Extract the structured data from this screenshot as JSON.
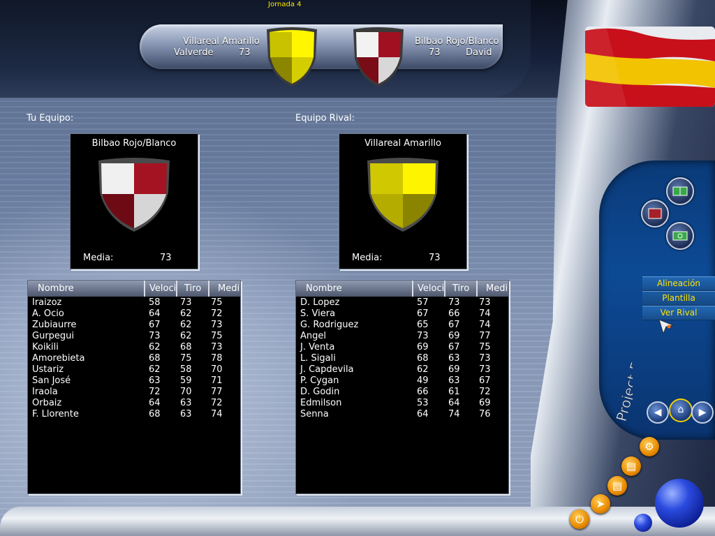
{
  "header": {
    "jornada": "Jornada 4",
    "home_team": "Villareal Amarillo",
    "home_coach": "Valverde",
    "home_rating": "73",
    "away_team": "Bilbao Rojo/Blanco",
    "away_rating": "73",
    "away_coach": "David"
  },
  "labels": {
    "your_team": "Tu Equipo:",
    "rival_team": "Equipo Rival:"
  },
  "my_team": {
    "name": "Bilbao Rojo/Blanco",
    "media_label": "Media:",
    "media_value": "73",
    "colors": {
      "primary": "#ffffff",
      "secondary": "#9a0f1c"
    }
  },
  "rival_team": {
    "name": "Villareal Amarillo",
    "media_label": "Media:",
    "media_value": "73",
    "colors": {
      "primary": "#f0e800",
      "secondary": "#8a8400"
    }
  },
  "table_columns": [
    "Nombre",
    "Velocidad",
    "Tiro",
    "Media"
  ],
  "my_players": [
    {
      "name": "Iraizoz",
      "vel": "58",
      "tiro": "73",
      "media": "75"
    },
    {
      "name": "A. Ocio",
      "vel": "64",
      "tiro": "62",
      "media": "72"
    },
    {
      "name": "Zubiaurre",
      "vel": "67",
      "tiro": "62",
      "media": "73"
    },
    {
      "name": "Gurpegui",
      "vel": "73",
      "tiro": "62",
      "media": "75"
    },
    {
      "name": "Koikili",
      "vel": "62",
      "tiro": "68",
      "media": "73"
    },
    {
      "name": "Amorebieta",
      "vel": "68",
      "tiro": "75",
      "media": "78"
    },
    {
      "name": "Ustariz",
      "vel": "62",
      "tiro": "58",
      "media": "70"
    },
    {
      "name": "San José",
      "vel": "63",
      "tiro": "59",
      "media": "71"
    },
    {
      "name": "Iraola",
      "vel": "72",
      "tiro": "70",
      "media": "77"
    },
    {
      "name": "Orbaiz",
      "vel": "64",
      "tiro": "63",
      "media": "72"
    },
    {
      "name": "F. Llorente",
      "vel": "68",
      "tiro": "63",
      "media": "74"
    }
  ],
  "rival_players": [
    {
      "name": "D. Lopez",
      "vel": "57",
      "tiro": "73",
      "media": "73"
    },
    {
      "name": "S. Viera",
      "vel": "67",
      "tiro": "66",
      "media": "74"
    },
    {
      "name": "G. Rodriguez",
      "vel": "65",
      "tiro": "67",
      "media": "74"
    },
    {
      "name": "Angel",
      "vel": "73",
      "tiro": "69",
      "media": "77"
    },
    {
      "name": "J. Venta",
      "vel": "69",
      "tiro": "67",
      "media": "75"
    },
    {
      "name": "L. Sigali",
      "vel": "68",
      "tiro": "63",
      "media": "73"
    },
    {
      "name": "J. Capdevila",
      "vel": "62",
      "tiro": "69",
      "media": "73"
    },
    {
      "name": "P. Cygan",
      "vel": "49",
      "tiro": "63",
      "media": "67"
    },
    {
      "name": "D. Godin",
      "vel": "66",
      "tiro": "61",
      "media": "72"
    },
    {
      "name": "Edmilson",
      "vel": "53",
      "tiro": "64",
      "media": "69"
    },
    {
      "name": "Senna",
      "vel": "64",
      "tiro": "74",
      "media": "76"
    }
  ],
  "side_menu": {
    "items": [
      "Alineación",
      "Plantilla",
      "Ver Rival"
    ],
    "brand": "Project Football"
  },
  "icons": {
    "formation": "pitch-icon",
    "tactics": "tactics-icon",
    "stats": "stats-icon",
    "back": "arrow-left-icon",
    "home": "home-icon",
    "forward": "arrow-right-icon",
    "settings": "gear-icon",
    "print": "print-icon",
    "save": "printer-icon",
    "exit": "exit-icon",
    "power": "power-icon"
  },
  "accent_color": "#ffe400"
}
